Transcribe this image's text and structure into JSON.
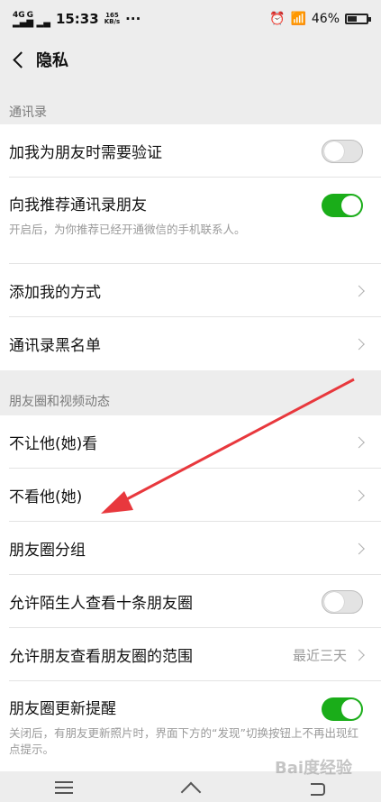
{
  "status": {
    "network": "4G",
    "signal2": "G",
    "time": "15:33",
    "speed_value": "165",
    "speed_unit": "KB/s",
    "more": "···",
    "battery": "46%",
    "battery_level": 0.46
  },
  "nav": {
    "title": "隐私"
  },
  "sections": {
    "contacts_title": "通讯录",
    "moments_title": "朋友圈和视频动态"
  },
  "rows": {
    "verify": {
      "label": "加我为朋友时需要验证",
      "on": false
    },
    "recommend": {
      "label": "向我推荐通讯录朋友",
      "desc": "开启后，为你推荐已经开通微信的手机联系人。",
      "on": true
    },
    "add_method": {
      "label": "添加我的方式"
    },
    "blacklist": {
      "label": "通讯录黑名单"
    },
    "block_view": {
      "label": "不让他(她)看"
    },
    "hide_their": {
      "label": "不看他(她)"
    },
    "groups": {
      "label": "朋友圈分组"
    },
    "stranger": {
      "label": "允许陌生人查看十条朋友圈",
      "on": false
    },
    "range": {
      "label": "允许朋友查看朋友圈的范围",
      "value": "最近三天"
    },
    "update": {
      "label": "朋友圈更新提醒",
      "desc": "关闭后，有朋友更新照片时，界面下方的“发现”切换按钮上不再出现红点提示。",
      "on": true
    }
  },
  "colors": {
    "accent": "#1aad19",
    "annotation": "#e8383d"
  },
  "watermark": "Bai度经验"
}
